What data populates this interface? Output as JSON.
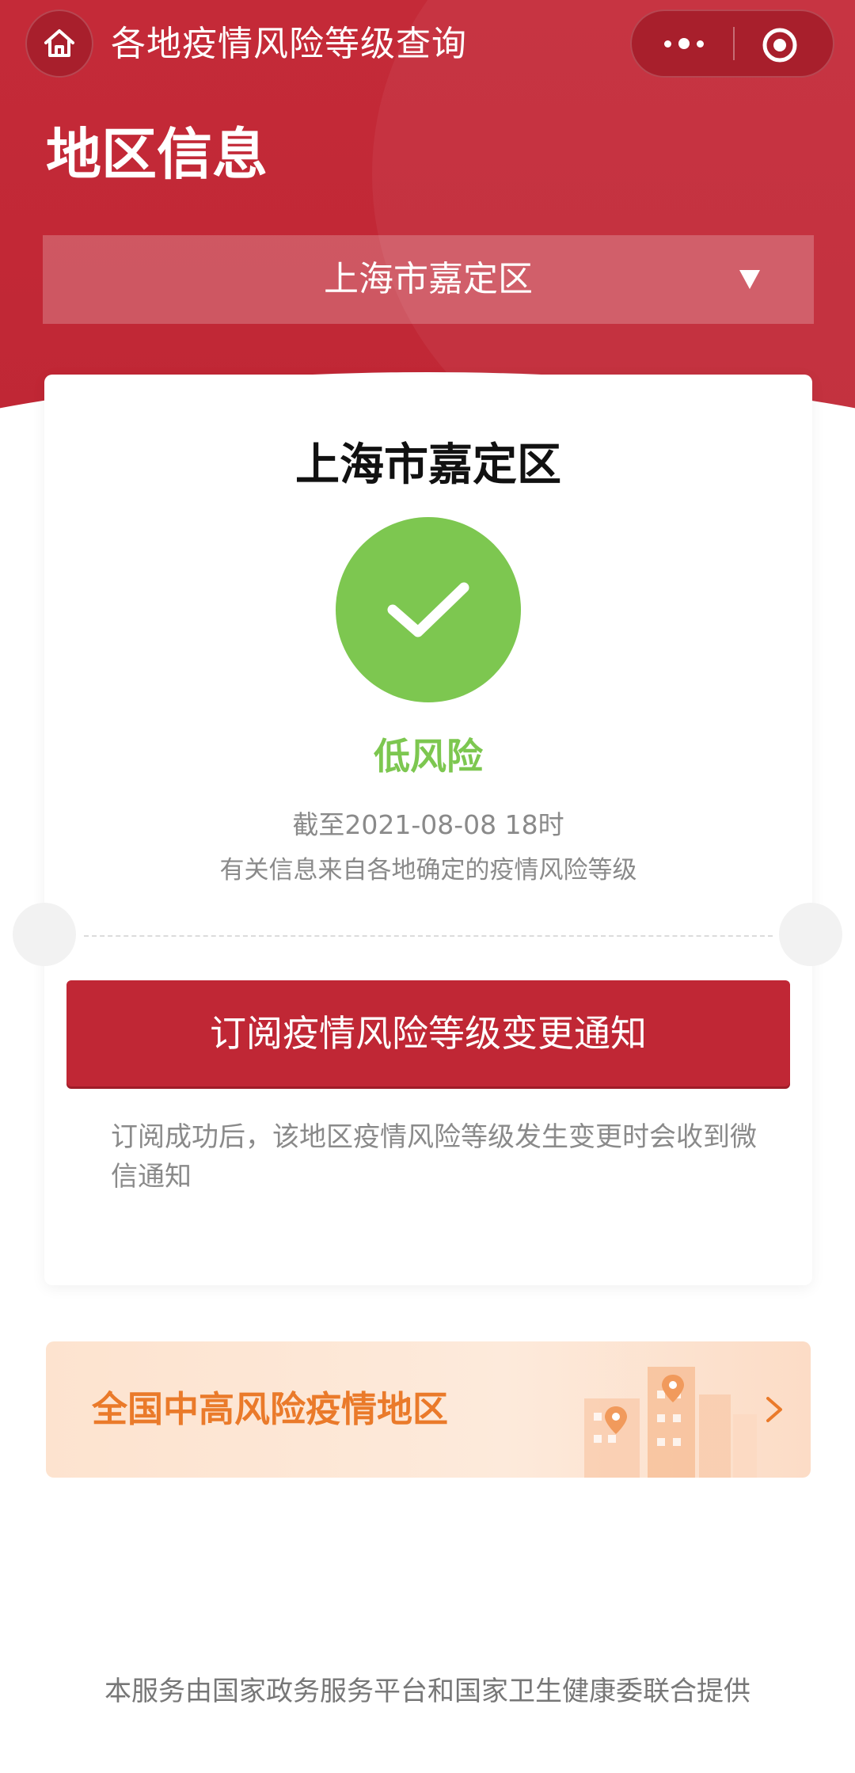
{
  "header": {
    "app_title": "各地疫情风险等级查询",
    "home_icon": "home-icon",
    "more_icon": "more-icon",
    "close_icon": "target-icon"
  },
  "region_section": {
    "title": "地区信息",
    "selected_region": "上海市嘉定区"
  },
  "result_card": {
    "region": "上海市嘉定区",
    "status_icon": "check-icon",
    "risk_level": "低风险",
    "risk_color": "#7dc750",
    "update_time": "截至2021-08-08 18时",
    "info_source": "有关信息来自各地确定的疫情风险等级",
    "subscribe_button": "订阅疫情风险等级变更通知",
    "subscribe_note": "订阅成功后，该地区疫情风险等级发生变更时会收到微信通知"
  },
  "banner": {
    "label": "全国中高风险疫情地区"
  },
  "footer": {
    "text": "本服务由国家政务服务平台和国家卫生健康委联合提供"
  },
  "colors": {
    "brand_red": "#c02735",
    "accent_orange": "#ea7a2a"
  }
}
